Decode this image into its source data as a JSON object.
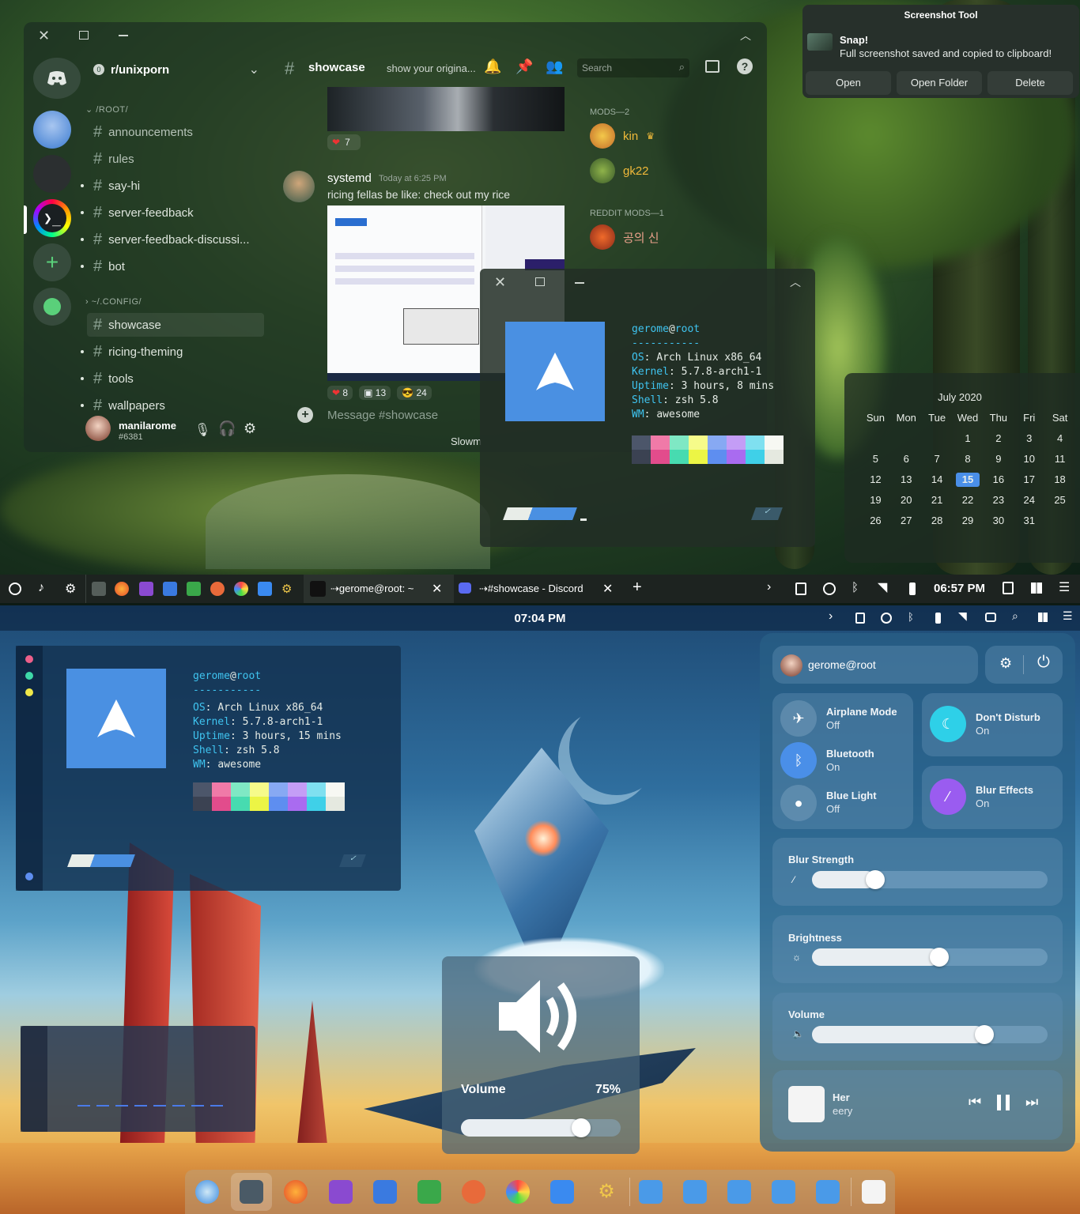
{
  "discord": {
    "server_name": "r/unixporn",
    "server_badge": "0",
    "channel": "showcase",
    "channel_topic": "show your origina...",
    "search_placeholder": "Search",
    "categories": [
      "/ROOT/",
      "~/.CONFIG/"
    ],
    "channels_root": [
      "announcements",
      "rules",
      "say-hi",
      "server-feedback",
      "server-feedback-discussi...",
      "bot"
    ],
    "channels_config": [
      "showcase",
      "ricing-theming",
      "tools",
      "wallpapers"
    ],
    "message": {
      "author": "systemd",
      "timestamp": "Today at 6:25 PM",
      "text": "ricing fellas be like: check out my rice",
      "reaction_top_count": "7",
      "reactions": [
        {
          "icon": "heart-icon",
          "count": "8"
        },
        {
          "icon": "image-emoji-icon",
          "count": "13"
        },
        {
          "icon": "sunglasses-emoji-icon",
          "count": "24"
        }
      ]
    },
    "composer_placeholder": "Message #showcase",
    "slowmode": "Slowm",
    "user": {
      "name": "manilarome",
      "tag": "#6381"
    },
    "members": {
      "mods_header": "MODS—2",
      "mods": [
        "kin",
        "gk22"
      ],
      "reddit_header": "REDDIT MODS—1",
      "reddit_mods": [
        "공의 신"
      ]
    }
  },
  "neofetch": {
    "user": "gerome",
    "at": "@",
    "host": "root",
    "sep": "-----------",
    "lines_top": [
      {
        "label": "OS",
        "value": "Arch Linux x86_64"
      },
      {
        "label": "Kernel",
        "value": "5.7.8-arch1-1"
      },
      {
        "label": "Uptime",
        "value": "3 hours, 8 mins"
      },
      {
        "label": "Shell",
        "value": "zsh 5.8"
      },
      {
        "label": "WM",
        "value": "awesome"
      }
    ],
    "lines_bottom": [
      {
        "label": "OS",
        "value": "Arch Linux x86_64"
      },
      {
        "label": "Kernel",
        "value": "5.7.8-arch1-1"
      },
      {
        "label": "Uptime",
        "value": "3 hours, 15 mins"
      },
      {
        "label": "Shell",
        "value": "zsh 5.8"
      },
      {
        "label": "WM",
        "value": "awesome"
      }
    ],
    "palette": [
      "#3b4252",
      "#e24c8c",
      "#47dbb0",
      "#ecf545",
      "#5e8ef0",
      "#a96bf0",
      "#3fd0e8",
      "#e5e9e0"
    ],
    "palette_light": [
      "#4c566a",
      "#f07aa8",
      "#7fe8c4",
      "#f6fb8a",
      "#87a9f3",
      "#c49df6",
      "#7fe0f0",
      "#f7f8f3"
    ]
  },
  "notification": {
    "app": "Screenshot Tool",
    "title": "Snap!",
    "body": "Full screenshot saved and copied to clipboard!",
    "actions": [
      "Open",
      "Open Folder",
      "Delete"
    ]
  },
  "calendar": {
    "month": "July 2020",
    "weekdays": [
      "Sun",
      "Mon",
      "Tue",
      "Wed",
      "Thu",
      "Fri",
      "Sat"
    ],
    "days": [
      "",
      "",
      "",
      "1",
      "2",
      "3",
      "4",
      "5",
      "6",
      "7",
      "8",
      "9",
      "10",
      "11",
      "12",
      "13",
      "14",
      "15",
      "16",
      "17",
      "18",
      "19",
      "20",
      "21",
      "22",
      "23",
      "24",
      "25",
      "26",
      "27",
      "28",
      "29",
      "30",
      "31"
    ],
    "today": "15"
  },
  "taskbar": {
    "tasks": [
      "⇢gerome@root: ~",
      "⇢#showcase - Discord"
    ],
    "time": "06:57 PM"
  },
  "bottom": {
    "clock": "07:04 PM",
    "qs": {
      "user": "gerome@root",
      "toggles": [
        {
          "title": "Airplane Mode",
          "state": "Off"
        },
        {
          "title": "Bluetooth",
          "state": "On"
        },
        {
          "title": "Blue Light",
          "state": "Off"
        },
        {
          "title": "Don't Disturb",
          "state": "On"
        },
        {
          "title": "Blur Effects",
          "state": "On"
        }
      ],
      "sliders": [
        {
          "title": "Blur Strength",
          "value": 0.27
        },
        {
          "title": "Brightness",
          "value": 0.54
        },
        {
          "title": "Volume",
          "value": 0.73
        }
      ],
      "media": {
        "title": "Her",
        "artist": "eery"
      }
    },
    "osd": {
      "label": "Volume",
      "value_text": "75%",
      "value": 0.75
    }
  },
  "colors": {
    "accent": "#3fc4f0",
    "bluetooth_on": "#4a8fe8",
    "dnd_on": "#2ed0e8",
    "blur_on": "#9a5cf0",
    "today_bg": "#4a8fe8"
  }
}
